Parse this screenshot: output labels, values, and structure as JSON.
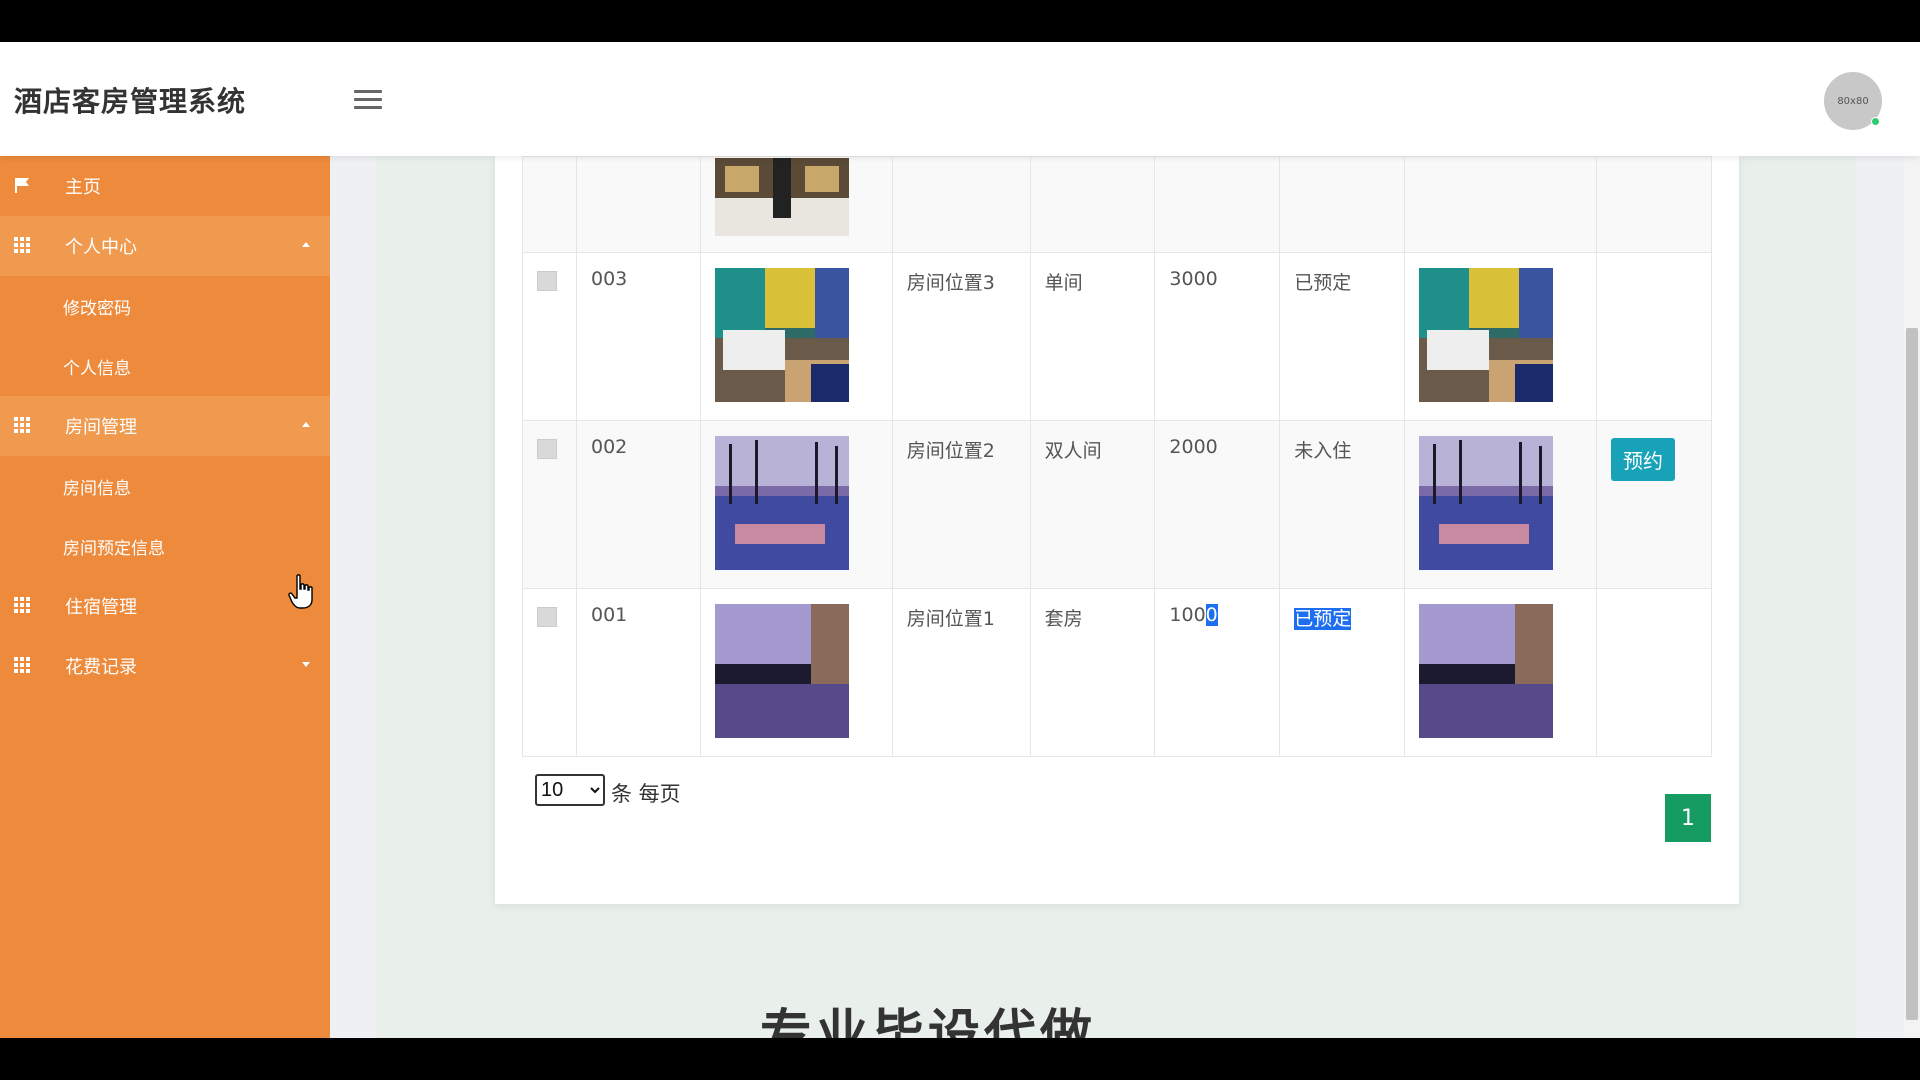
{
  "header": {
    "title": "酒店客房管理系统",
    "avatar_text": "80x80"
  },
  "sidebar": {
    "items": [
      {
        "label": "主页",
        "icon": "flag-icon"
      },
      {
        "label": "个人中心",
        "icon": "grid-icon",
        "expanded": true,
        "children": [
          {
            "label": "修改密码"
          },
          {
            "label": "个人信息"
          }
        ]
      },
      {
        "label": "房间管理",
        "icon": "grid-icon",
        "expanded": true,
        "children": [
          {
            "label": "房间信息"
          },
          {
            "label": "房间预定信息"
          }
        ]
      },
      {
        "label": "住宿管理",
        "icon": "grid-icon"
      },
      {
        "label": "花费记录",
        "icon": "grid-icon",
        "expanded": false
      }
    ]
  },
  "table": {
    "rows": [
      {
        "id": "003",
        "location": "房间位置3",
        "type": "单间",
        "price": "3000",
        "status": "已预定",
        "action": "",
        "image": "room-bedroom"
      },
      {
        "id": "002",
        "location": "房间位置2",
        "type": "双人间",
        "price": "2000",
        "status": "未入住",
        "action": "预约",
        "image": "pool-palms"
      },
      {
        "id": "001",
        "location": "房间位置1",
        "type": "套房",
        "price_a": "100",
        "price_b": "0",
        "status": "已预定",
        "action": "",
        "image": "pool-night"
      }
    ]
  },
  "pagination": {
    "per_page_value": "10",
    "per_page_options": [
      "10"
    ],
    "per_page_label": "条 每页",
    "current_page": "1"
  },
  "promo_text": "专业毕设代做",
  "colors": {
    "sidebar": "#ed8a3b",
    "sidebar_parent": "#f09a4f",
    "primary_button": "#17a2b8",
    "page_active": "#169b62"
  }
}
